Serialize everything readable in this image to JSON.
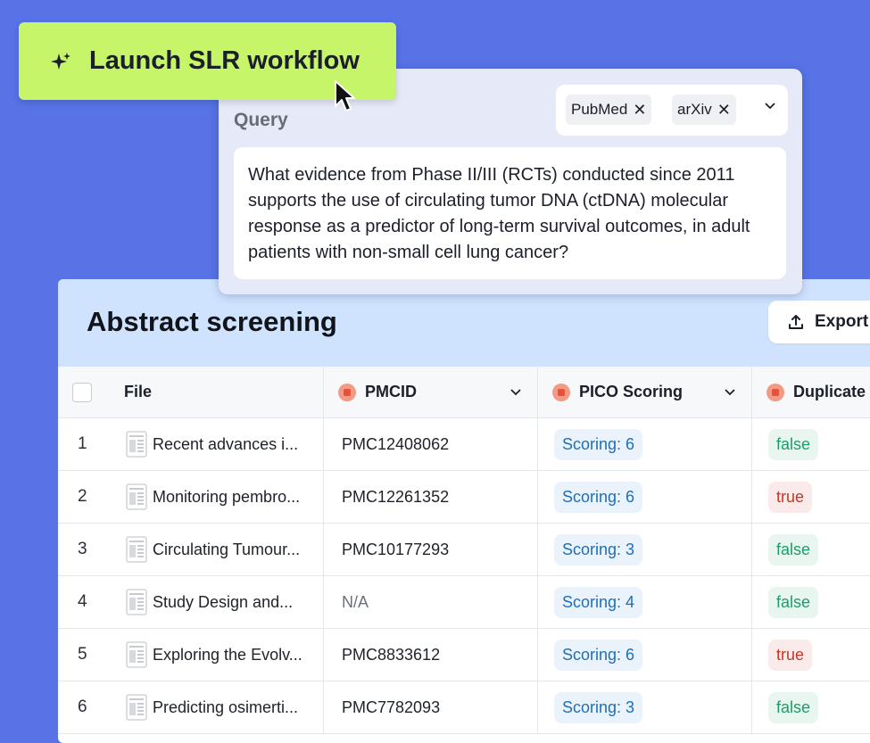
{
  "launch": {
    "label": "Launch SLR workflow",
    "icon": "sparkle-icon"
  },
  "query": {
    "label": "Query",
    "sources": [
      "PubMed",
      "arXiv"
    ],
    "text": "What evidence from Phase II/III (RCTs) conducted since 2011 supports the use of circulating tumor DNA (ctDNA) molecular response as a predictor of long-term survival outcomes, in adult patients with non-small cell lung cancer?"
  },
  "screening": {
    "title": "Abstract screening",
    "export_label": "Export",
    "columns": {
      "file": "File",
      "pmcid": "PMCID",
      "pico": "PICO Scoring",
      "duplicate": "Duplicate"
    },
    "rows": [
      {
        "idx": "1",
        "file": "Recent advances i...",
        "pmcid": "PMC12408062",
        "score": "Scoring: 6",
        "duplicate": "false"
      },
      {
        "idx": "2",
        "file": "Monitoring pembro...",
        "pmcid": "PMC12261352",
        "score": "Scoring: 6",
        "duplicate": "true"
      },
      {
        "idx": "3",
        "file": "Circulating Tumour...",
        "pmcid": "PMC10177293",
        "score": "Scoring: 3",
        "duplicate": "false"
      },
      {
        "idx": "4",
        "file": "Study Design and...",
        "pmcid": "N/A",
        "score": "Scoring: 4",
        "duplicate": "false"
      },
      {
        "idx": "5",
        "file": "Exploring the Evolv...",
        "pmcid": "PMC8833612",
        "score": "Scoring: 6",
        "duplicate": "true"
      },
      {
        "idx": "6",
        "file": "Predicting osimerti...",
        "pmcid": "PMC7782093",
        "score": "Scoring: 3",
        "duplicate": "false"
      }
    ]
  },
  "colors": {
    "background": "#5773e6",
    "launch_button": "#c7f56a",
    "header_bar": "#cfe3ff",
    "score_text": "#1f6fb5",
    "false_text": "#1f9b6a",
    "true_text": "#c0392b"
  }
}
